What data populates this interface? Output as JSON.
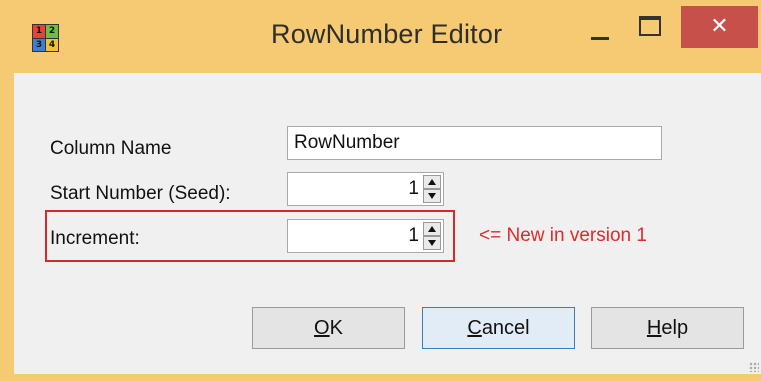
{
  "window": {
    "title": "RowNumber Editor",
    "icon_digits": [
      "1",
      "2",
      "3",
      "4"
    ],
    "close_glyph": "✕"
  },
  "form": {
    "column_name_label": "Column Name",
    "column_name_value": "RowNumber",
    "start_number_label": "Start Number (Seed):",
    "start_number_value": "1",
    "increment_label": "Increment:",
    "increment_value": "1"
  },
  "annotation": {
    "note": "<= New in version 1",
    "highlight_color": "#d32a2a"
  },
  "buttons": {
    "ok_prefix": "",
    "ok_mnemonic": "O",
    "ok_rest": "K",
    "cancel_mnemonic": "C",
    "cancel_rest": "ancel",
    "help_mnemonic": "H",
    "help_rest": "elp"
  },
  "colors": {
    "titlebar": "#f5ca72",
    "close_button": "#c7504a",
    "client": "#f0f0f0"
  },
  "icons": {
    "app": "numbered-grid-icon",
    "minimize": "minimize-icon",
    "maximize": "maximize-icon",
    "close": "close-icon",
    "spin_up": "spin-up-arrow-icon",
    "spin_down": "spin-down-arrow-icon"
  }
}
